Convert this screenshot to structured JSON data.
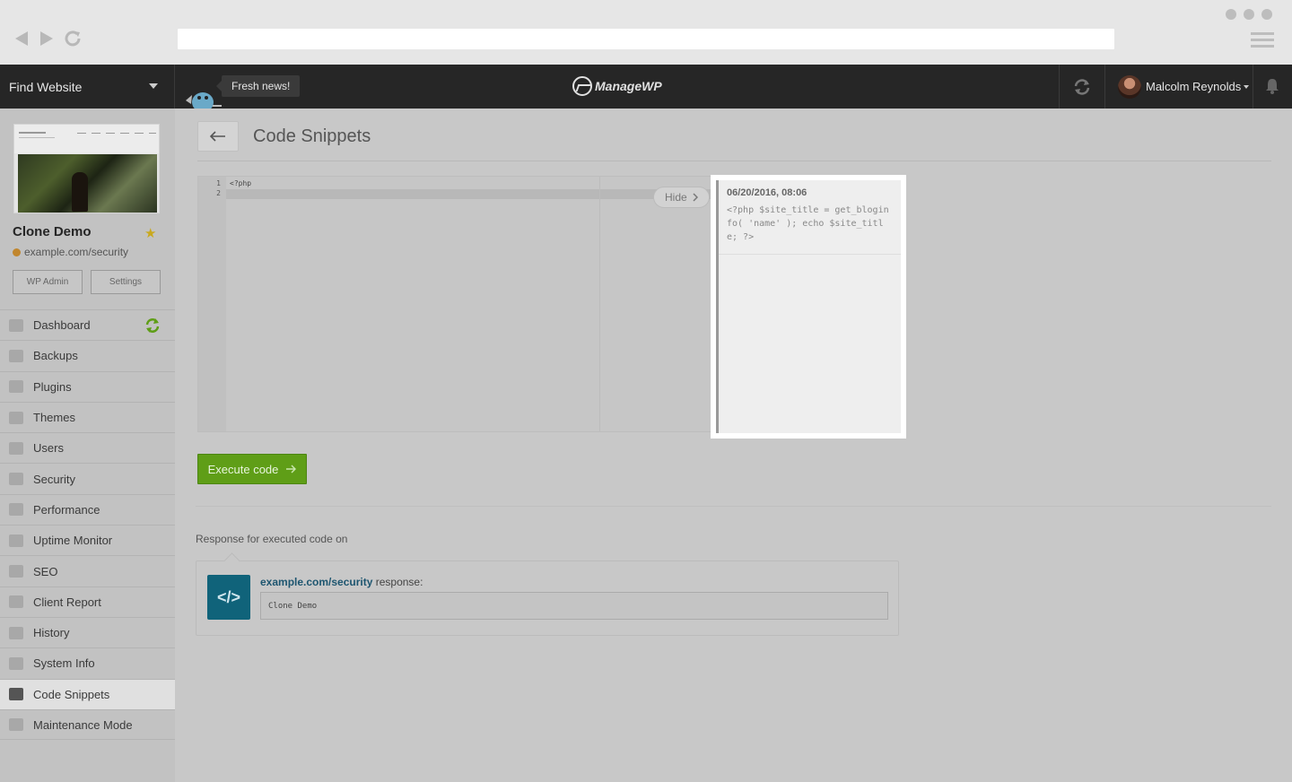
{
  "browser": {
    "back_icon": "triangle-left-icon",
    "forward_icon": "triangle-right-icon",
    "reload_icon": "reload-icon"
  },
  "topbar": {
    "find_website": "Find Website",
    "news_label": "Fresh news!",
    "logo_text": "ManageWP",
    "user_name": "Malcolm Reynolds"
  },
  "site": {
    "name": "Clone Demo",
    "url": "example.com/security",
    "wp_admin_label": "WP Admin",
    "settings_label": "Settings"
  },
  "sidebar": {
    "items": [
      {
        "label": "Dashboard",
        "icon": "monitor-icon"
      },
      {
        "label": "Backups",
        "icon": "backup-icon"
      },
      {
        "label": "Plugins",
        "icon": "plug-icon"
      },
      {
        "label": "Themes",
        "icon": "palette-icon"
      },
      {
        "label": "Users",
        "icon": "users-icon"
      },
      {
        "label": "Security",
        "icon": "shield-icon"
      },
      {
        "label": "Performance",
        "icon": "speedometer-icon"
      },
      {
        "label": "Uptime Monitor",
        "icon": "arrow-up-icon"
      },
      {
        "label": "SEO",
        "icon": "megaphone-icon"
      },
      {
        "label": "Client Report",
        "icon": "chart-icon"
      },
      {
        "label": "History",
        "icon": "clock-icon"
      },
      {
        "label": "System Info",
        "icon": "server-icon"
      },
      {
        "label": "Code Snippets",
        "icon": "terminal-icon"
      },
      {
        "label": "Maintenance Mode",
        "icon": "barrier-icon"
      }
    ],
    "active": "Code Snippets"
  },
  "main": {
    "title": "Code Snippets",
    "editor": {
      "line_numbers": [
        "1",
        "2"
      ],
      "line1": "<?php"
    },
    "hide_label": "Hide",
    "history": {
      "date": "06/20/2016, 08:06",
      "code": "<?php $site_title = get_bloginfo( 'name' ); echo $site_title; ?>"
    },
    "execute_label": "Execute code",
    "response_label": "Response for executed code on",
    "response": {
      "site": "example.com/security",
      "suffix": " response:",
      "output": "Clone Demo"
    }
  },
  "colors": {
    "accent_green": "#5f9e17",
    "response_icon_bg": "#10637a",
    "link_blue": "#1e5670",
    "star_gold": "#c9a91e"
  }
}
